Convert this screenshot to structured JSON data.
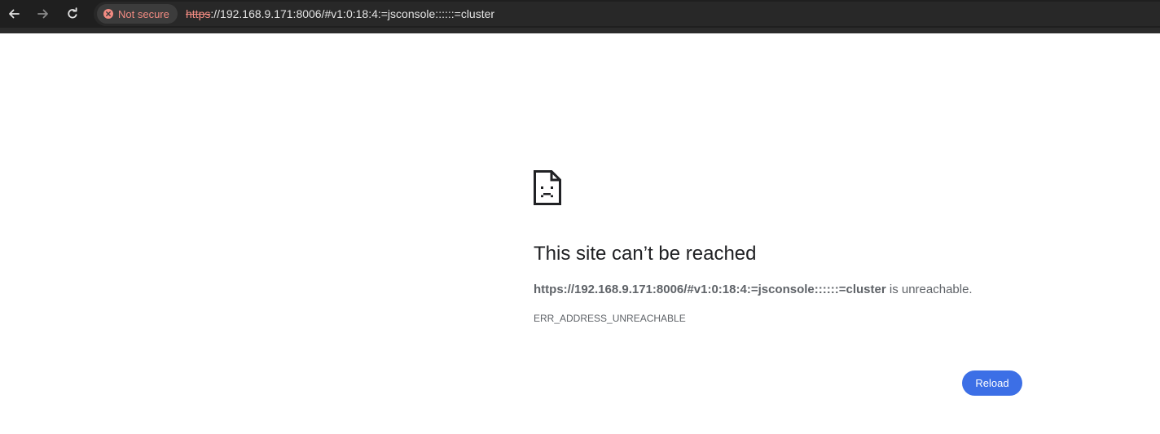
{
  "browser": {
    "security_label": "Not secure",
    "url_scheme": "https",
    "url_rest": "://192.168.9.171:8006/#v1:0:18:4:=jsconsole::::::=cluster",
    "icons": {
      "back": "arrow-left-icon",
      "forward": "arrow-right-icon",
      "reload": "reload-icon",
      "security": "warning-circle-icon"
    },
    "colors": {
      "toolbar_bg": "#1f1f1f",
      "omnibox_bg": "#282828",
      "security_text": "#f28b82"
    }
  },
  "error_page": {
    "icon": "sad-page-icon",
    "heading": "This site can’t be reached",
    "url_bold": "https://192.168.9.171:8006/#v1:0:18:4:=jsconsole::::::=cluster",
    "summary_suffix": " is unreachable.",
    "error_code": "ERR_ADDRESS_UNREACHABLE",
    "reload_label": "Reload",
    "colors": {
      "button_bg": "#3c6fe6",
      "heading_text": "#202124",
      "body_text": "#5f6368"
    }
  }
}
